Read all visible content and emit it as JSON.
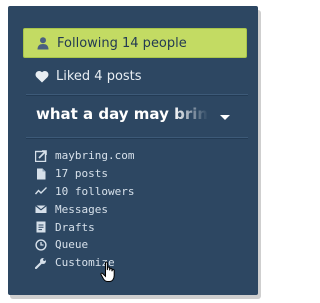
{
  "following": {
    "label": "Following 14 people"
  },
  "liked": {
    "label": "Liked 4 posts"
  },
  "blog": {
    "title": "what a day may bring"
  },
  "menu": [
    {
      "label": "maybring.com",
      "icon": "external-link-icon"
    },
    {
      "label": "17 posts",
      "icon": "document-icon"
    },
    {
      "label": "10 followers",
      "icon": "activity-icon"
    },
    {
      "label": "Messages",
      "icon": "envelope-icon"
    },
    {
      "label": "Drafts",
      "icon": "draft-icon"
    },
    {
      "label": "Queue",
      "icon": "clock-icon"
    },
    {
      "label": "Customize",
      "icon": "wrench-icon"
    }
  ],
  "colors": {
    "panel": "#2d4762",
    "following_bg": "#c3db63",
    "text": "#d6e0ea"
  }
}
